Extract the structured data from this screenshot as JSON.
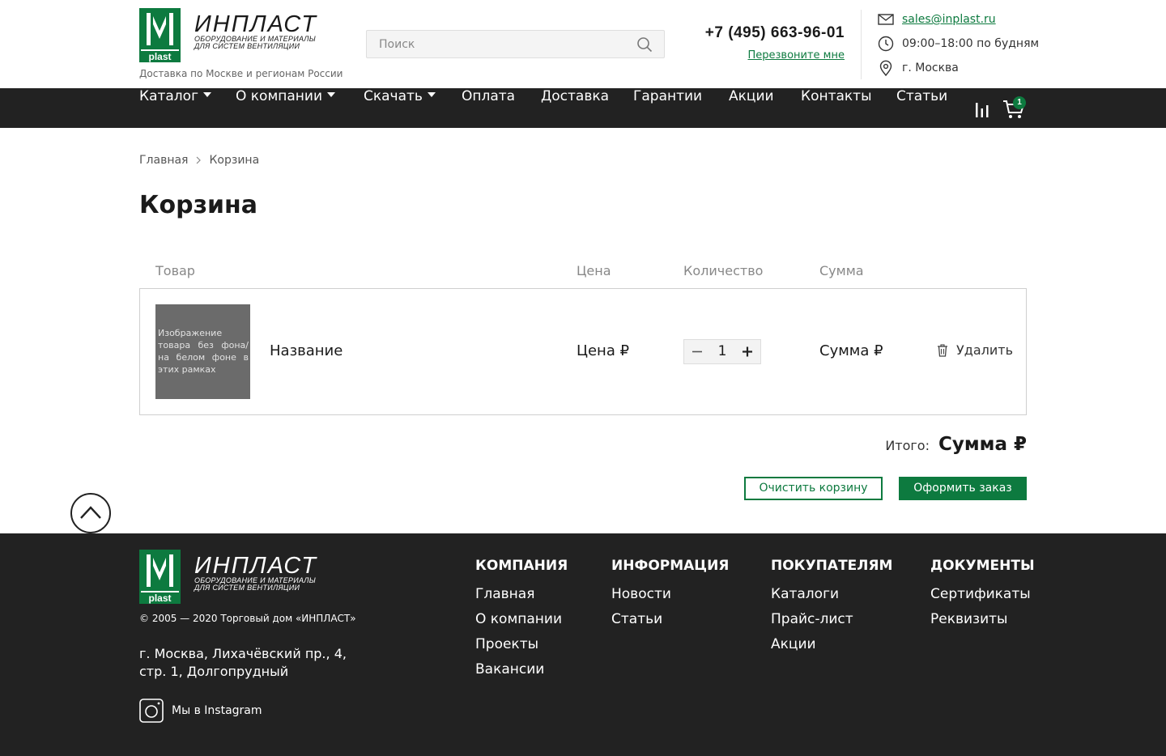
{
  "header": {
    "logo_brand": "ИНПЛАСТ",
    "logo_sub_1": "ОБОРУДОВАНИЕ И МАТЕРИАЛЫ",
    "logo_sub_2": "ДЛЯ СИСТЕМ ВЕНТИЛЯЦИИ",
    "logo_badge": "plast",
    "delivery": "Доставка по Москве и регионам России",
    "search_placeholder": "Поиск",
    "phone": "+7 (495) 663-96-01",
    "callback": "Перезвоните мне",
    "email": "sales@inplast.ru",
    "hours": "09:00–18:00 по будням",
    "city": "г. Москва"
  },
  "nav": {
    "items": [
      {
        "label": "Каталог"
      },
      {
        "label": "О компании"
      },
      {
        "label": "Скачать"
      },
      {
        "label": "Оплата"
      },
      {
        "label": "Доставка"
      },
      {
        "label": "Гарантии"
      },
      {
        "label": "Акции"
      },
      {
        "label": "Контакты"
      },
      {
        "label": "Статьи"
      }
    ],
    "cart_count": "1"
  },
  "breadcrumb": {
    "home": "Главная",
    "current": "Корзина"
  },
  "page_title": "Корзина",
  "table": {
    "columns": {
      "product": "Товар",
      "price": "Цена",
      "qty": "Количество",
      "sum": "Сумма"
    },
    "rows": [
      {
        "image_text": "Изображение товара без фона/на белом фоне в этих рамках",
        "name": "Название",
        "price": "Цена ₽",
        "qty": "1",
        "sum": "Сумма ₽",
        "delete": "Удалить"
      }
    ]
  },
  "summary": {
    "label": "Итого:",
    "value": "Сумма ₽"
  },
  "actions": {
    "clear": "Очистить корзину",
    "order": "Оформить заказ"
  },
  "footer": {
    "copyright": "© 2005 — 2020 Торговый дом «ИНПЛАСТ»",
    "address": "г. Москва, Лихачёвский пр., 4, стр. 1, Долгопрудный",
    "instagram": "Мы в Instagram",
    "columns": [
      {
        "title": "КОМПАНИЯ",
        "links": [
          "Главная",
          "О компании",
          "Проекты",
          "Вакансии"
        ]
      },
      {
        "title": "ИНФОРМАЦИЯ",
        "links": [
          "Новости",
          "Статьи"
        ]
      },
      {
        "title": "ПОКУПАТЕЛЯМ",
        "links": [
          "Каталоги",
          "Прайс-лист",
          "Акции"
        ]
      },
      {
        "title": "ДОКУМЕНТЫ",
        "links": [
          "Сертификаты",
          "Реквизиты"
        ]
      }
    ]
  },
  "colors": {
    "accent": "#0d7a3f",
    "nav_bg": "#222222",
    "footer_bg": "#222222"
  }
}
